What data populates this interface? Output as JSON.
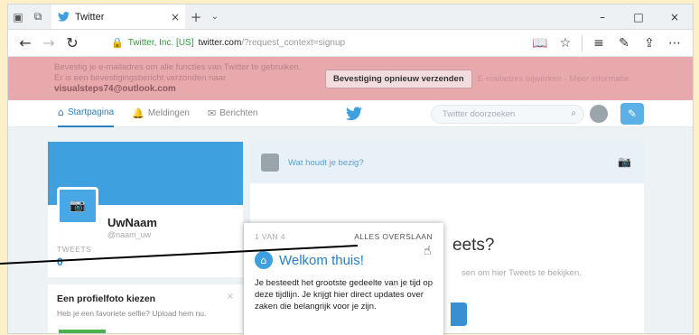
{
  "browser": {
    "tab_title": "Twitter",
    "tab_close": "×",
    "new_tab": "+",
    "tab_menu": "⌄",
    "win_minimize": "–",
    "win_maximize": "□",
    "win_close": "×",
    "address": {
      "site_name": "Twitter, Inc. [US]",
      "host": "twitter.com",
      "path": "/?request_context=signup"
    }
  },
  "banner": {
    "text": "Bevestig je e-mailadres om alle functies van Twitter te gebruiken. Er is een bevestigingsbericht verzonden naar",
    "email": "visualsteps74@outlook.com",
    "resend_label": "Bevestiging opnieuw verzenden",
    "link_label": "E-mailadres bijwerken · Meer informatie"
  },
  "nav": {
    "home": "Startpagina",
    "notifications": "Meldingen",
    "messages": "Berichten",
    "search_placeholder": "Twitter doorzoeken"
  },
  "profile": {
    "name": "UwNaam",
    "handle": "@naam_uw",
    "tweets_label": "TWEETS",
    "tweets_count": "0"
  },
  "tip": {
    "title": "Een profielfoto kiezen",
    "subtitle": "Heb je een favoriete selfie? Upload hem nu.",
    "close": "×"
  },
  "composer": {
    "placeholder": "Wat houdt je bezig?"
  },
  "empty_state": {
    "title": "eets?",
    "subtitle": "sen om hier Tweets te bekijken."
  },
  "modal": {
    "step": "1 VAN 4",
    "skip": "ALLES OVERSLAAN",
    "title": "Welkom thuis!",
    "body": "Je besteedt het grootste gedeelte van je tijd op deze tijdlijn. Je krijgt hier direct updates over zaken die belangrijk voor je zijn."
  },
  "colors": {
    "twitter_blue": "#3fa0e0",
    "banner_pink": "#e8a9ad",
    "page_background": "#fdf0c8"
  }
}
